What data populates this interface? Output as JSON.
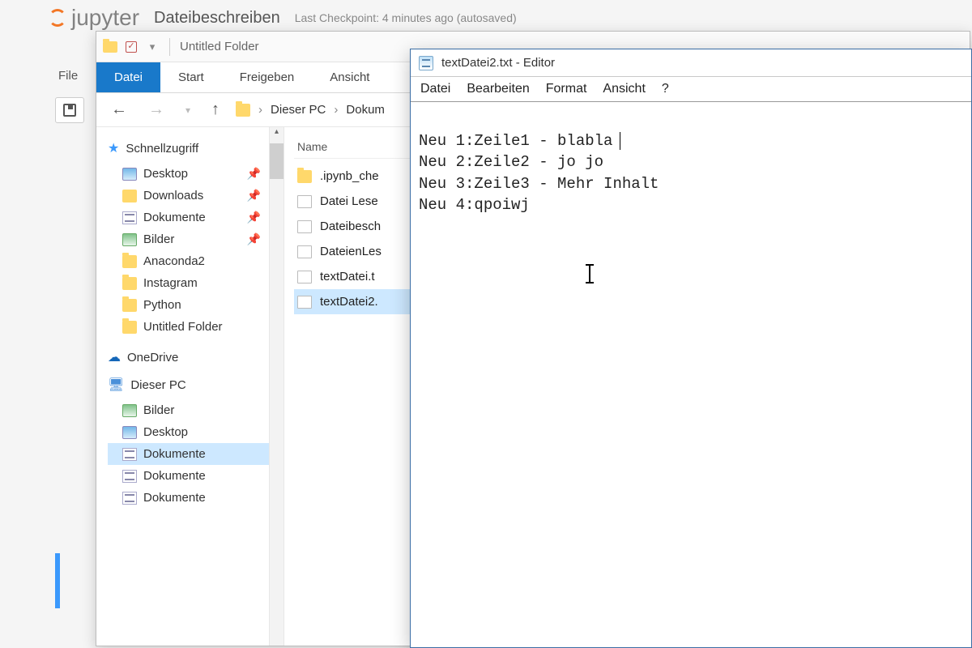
{
  "jupyter": {
    "logo_text": "jupyter",
    "doc_title": "Dateibeschreiben",
    "checkpoint": "Last Checkpoint: 4 minutes ago (autosaved)",
    "menu_first": "File"
  },
  "explorer": {
    "title_prefix": "",
    "title": "Untitled Folder",
    "ribbon": {
      "datei": "Datei",
      "start": "Start",
      "freigeben": "Freigeben",
      "ansicht": "Ansicht"
    },
    "breadcrumb": {
      "root": "Dieser PC",
      "folder": "Dokum"
    },
    "tree": {
      "quick_access": "Schnellzugriff",
      "quick_items": [
        {
          "label": "Desktop",
          "pinned": true,
          "icon": "desktop"
        },
        {
          "label": "Downloads",
          "pinned": true,
          "icon": "downloads"
        },
        {
          "label": "Dokumente",
          "pinned": true,
          "icon": "folder-doc"
        },
        {
          "label": "Bilder",
          "pinned": true,
          "icon": "pics"
        },
        {
          "label": "Anaconda2",
          "pinned": false,
          "icon": "folder"
        },
        {
          "label": "Instagram",
          "pinned": false,
          "icon": "folder"
        },
        {
          "label": "Python",
          "pinned": false,
          "icon": "folder"
        },
        {
          "label": "Untitled Folder",
          "pinned": false,
          "icon": "folder"
        }
      ],
      "onedrive": "OneDrive",
      "thispc": "Dieser PC",
      "pc_items": [
        {
          "label": "Bilder",
          "icon": "pics"
        },
        {
          "label": "Desktop",
          "icon": "desktop"
        },
        {
          "label": "Dokumente",
          "icon": "folder-doc",
          "selected": true
        },
        {
          "label": "Dokumente",
          "icon": "folder-doc"
        },
        {
          "label": "Dokumente",
          "icon": "folder-doc"
        }
      ]
    },
    "list": {
      "header_name": "Name",
      "rows": [
        {
          "label": ".ipynb_che",
          "icon": "folder"
        },
        {
          "label": "Datei Lese",
          "icon": "file"
        },
        {
          "label": "Dateibesch",
          "icon": "file"
        },
        {
          "label": "DateienLes",
          "icon": "file"
        },
        {
          "label": "textDatei.t",
          "icon": "file"
        },
        {
          "label": "textDatei2.",
          "icon": "file",
          "selected": true
        }
      ]
    }
  },
  "notepad": {
    "title": "textDatei2.txt - Editor",
    "menu": {
      "datei": "Datei",
      "bearbeiten": "Bearbeiten",
      "format": "Format",
      "ansicht": "Ansicht",
      "help": "?"
    },
    "lines": [
      "Neu 1:Zeile1 - blabla",
      "Neu 2:Zeile2 - jo jo",
      "Neu 3:Zeile3 - Mehr Inhalt",
      "Neu 4:qpoiwj"
    ]
  }
}
